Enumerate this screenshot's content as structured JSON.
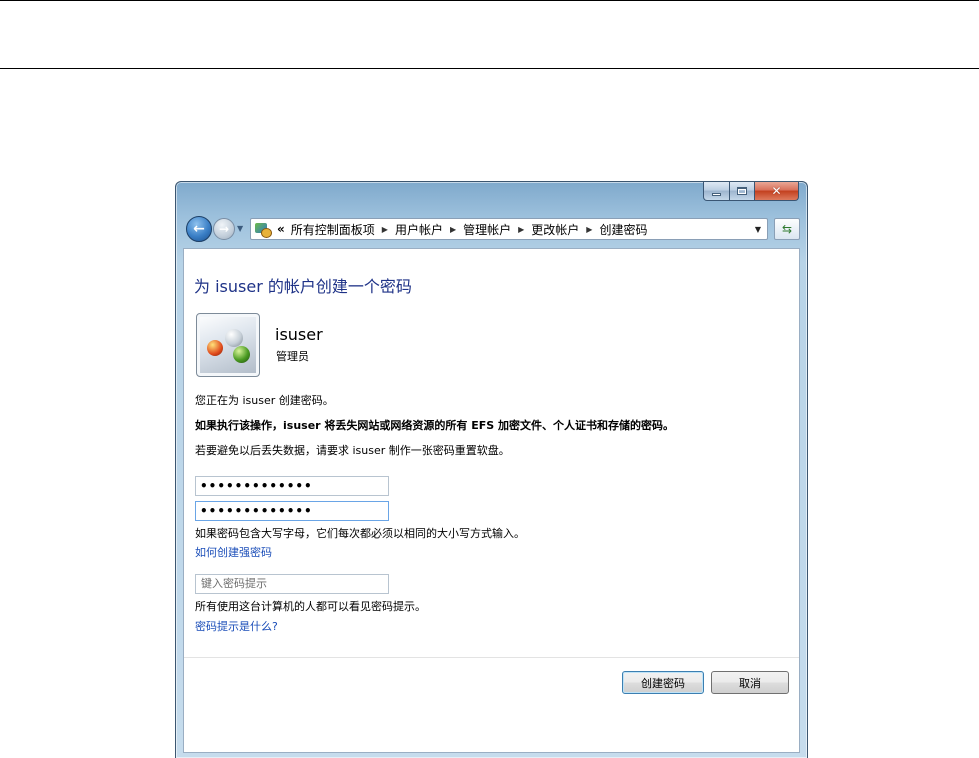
{
  "address_bar": {
    "overflow_label": "«",
    "crumbs": [
      "所有控制面板项",
      "用户帐户",
      "管理帐户",
      "更改帐户",
      "创建密码"
    ]
  },
  "window_controls": {
    "minimize": "—",
    "maximize": "□",
    "close": "✕"
  },
  "page": {
    "title": "为 isuser 的帐户创建一个密码",
    "user_name": "isuser",
    "user_role": "管理员",
    "intro": "您正在为 isuser 创建密码。",
    "warning": "如果执行该操作，isuser 将丢失网站或网络资源的所有 EFS 加密文件、个人证书和存储的密码。",
    "advice": "若要避免以后丢失数据，请要求 isuser 制作一张密码重置软盘。",
    "new_password_value": "•••••••••••••",
    "confirm_password_value": "•••••••••••••",
    "case_note": "如果密码包含大写字母，它们每次都必须以相同的大小写方式输入。",
    "strong_password_link": "如何创建强密码",
    "hint_placeholder": "键入密码提示",
    "hint_note": "所有使用这台计算机的人都可以看见密码提示。",
    "hint_link": "密码提示是什么?"
  },
  "buttons": {
    "create": "创建密码",
    "cancel": "取消"
  }
}
